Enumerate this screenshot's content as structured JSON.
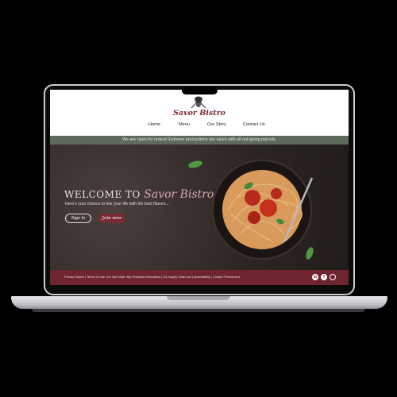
{
  "site": {
    "brand": "Savor Bistro",
    "nav": [
      "Home",
      "Menu",
      "Our Story",
      "Contact Us"
    ],
    "announcement": "We are open for orders! Extreme precautions are taken with all out-going parcels."
  },
  "hero": {
    "welcome_prefix": "WELCOME TO",
    "welcome_brand": "Savor Bistro",
    "tagline": "Here's your chance to live your life with the best flavors...",
    "signin_label": "Sign In",
    "join_label": "Join now"
  },
  "footer": {
    "links": "Privacy Notice | Terms of Use | Do Not Share My Personal Information | CA Supply Chain Act | Accessibility | Cookie Preferences",
    "social_icons": [
      "linkedin-icon",
      "facebook-icon",
      "instagram-icon"
    ]
  },
  "colors": {
    "accent": "#7a2a33",
    "info_bar": "#5d6a5c",
    "footer": "#6e2530"
  }
}
